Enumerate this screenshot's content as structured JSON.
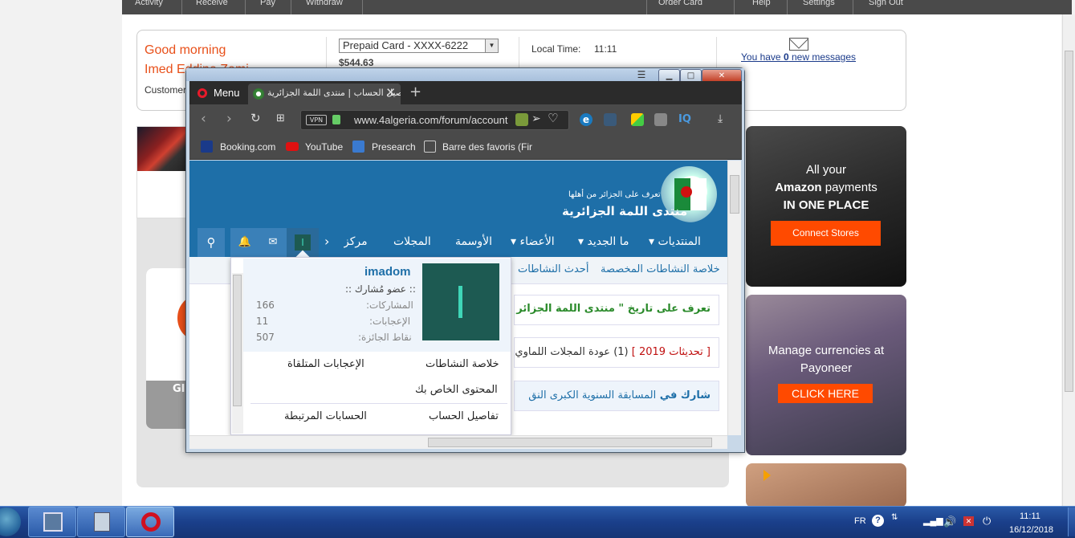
{
  "topnav": {
    "left": [
      "Activity",
      "Receive",
      "Pay",
      "Withdraw"
    ],
    "right": [
      "Order Card",
      "Help",
      "Settings",
      "Sign Out"
    ]
  },
  "account": {
    "greeting": "Good morning",
    "user_name": "Imed Eddine Zemi",
    "customer_label": "Customer",
    "card_select": "Prepaid Card - XXXX-6222",
    "balance": "$544.63",
    "local_time_label": "Local Time:",
    "local_time": "11:11",
    "messages_prefix": "You have ",
    "messages_count": "0",
    "messages_suffix": " new messages"
  },
  "left_panel": {
    "gi_text": "GI",
    "close_symbol": "✖"
  },
  "ads": {
    "amazon": {
      "line1": "All your",
      "brand": "Amazon",
      "line2_rest": " payments",
      "line3": "IN ONE PLACE",
      "button": "Connect Stores"
    },
    "payoneer": {
      "line1": "Manage currencies at",
      "line2": "Payoneer",
      "button": "CLICK HERE"
    }
  },
  "browser": {
    "menu_label": "Menu",
    "tab_title": "تفاصيل الحساب | منتدى اللمة الجزائرية",
    "new_tab": "+",
    "vpn_label": "VPN",
    "url": "www.4algeria.com/forum/account",
    "bookmarks": [
      "Booking.com",
      "YouTube",
      "Presearch",
      "Barre des favoris (Fire"
    ],
    "ext_iq": "IQ",
    "ext_e": "e"
  },
  "site": {
    "logo_tagline": "تعرف على الجزائر من أهلها",
    "logo_name": "منتدى اللمة الجزائرية",
    "nav": [
      "المنتديات",
      "ما الجديد",
      "الأعضاء",
      "الأوسمة",
      "المجلات",
      "مركز"
    ],
    "user_initial": "I",
    "subnav": [
      "خلاصة النشاطات المخصصة",
      "أحدث النشاطات"
    ],
    "box1": "تعرف على تاريخ \" منتدى اللمة الجزائر",
    "box2_tag": "[ تحديثات 2019 ]",
    "box2_count": "(1)",
    "box2_text": "عودة المجلات اللماوي",
    "box3_a": "شارك في",
    "box3_b": "المسابقة السنوية الكبرى النق"
  },
  "dropdown": {
    "username": "imadom",
    "rank": ":: عضو مُشارك ::",
    "stats": [
      {
        "label": "المشاركات:",
        "value": "166"
      },
      {
        "label": "الإعجابات:",
        "value": "11"
      },
      {
        "label": "نقاط الجائزة:",
        "value": "507"
      }
    ],
    "links": [
      "خلاصة النشاطات",
      "الإعجابات المتلقاة",
      "المحتوى الخاص بك",
      "تفاصيل الحساب",
      "الحسابات المرتبطة"
    ]
  },
  "taskbar": {
    "lang": "FR",
    "clock_time": "11:11",
    "clock_date": "16/12/2018"
  }
}
